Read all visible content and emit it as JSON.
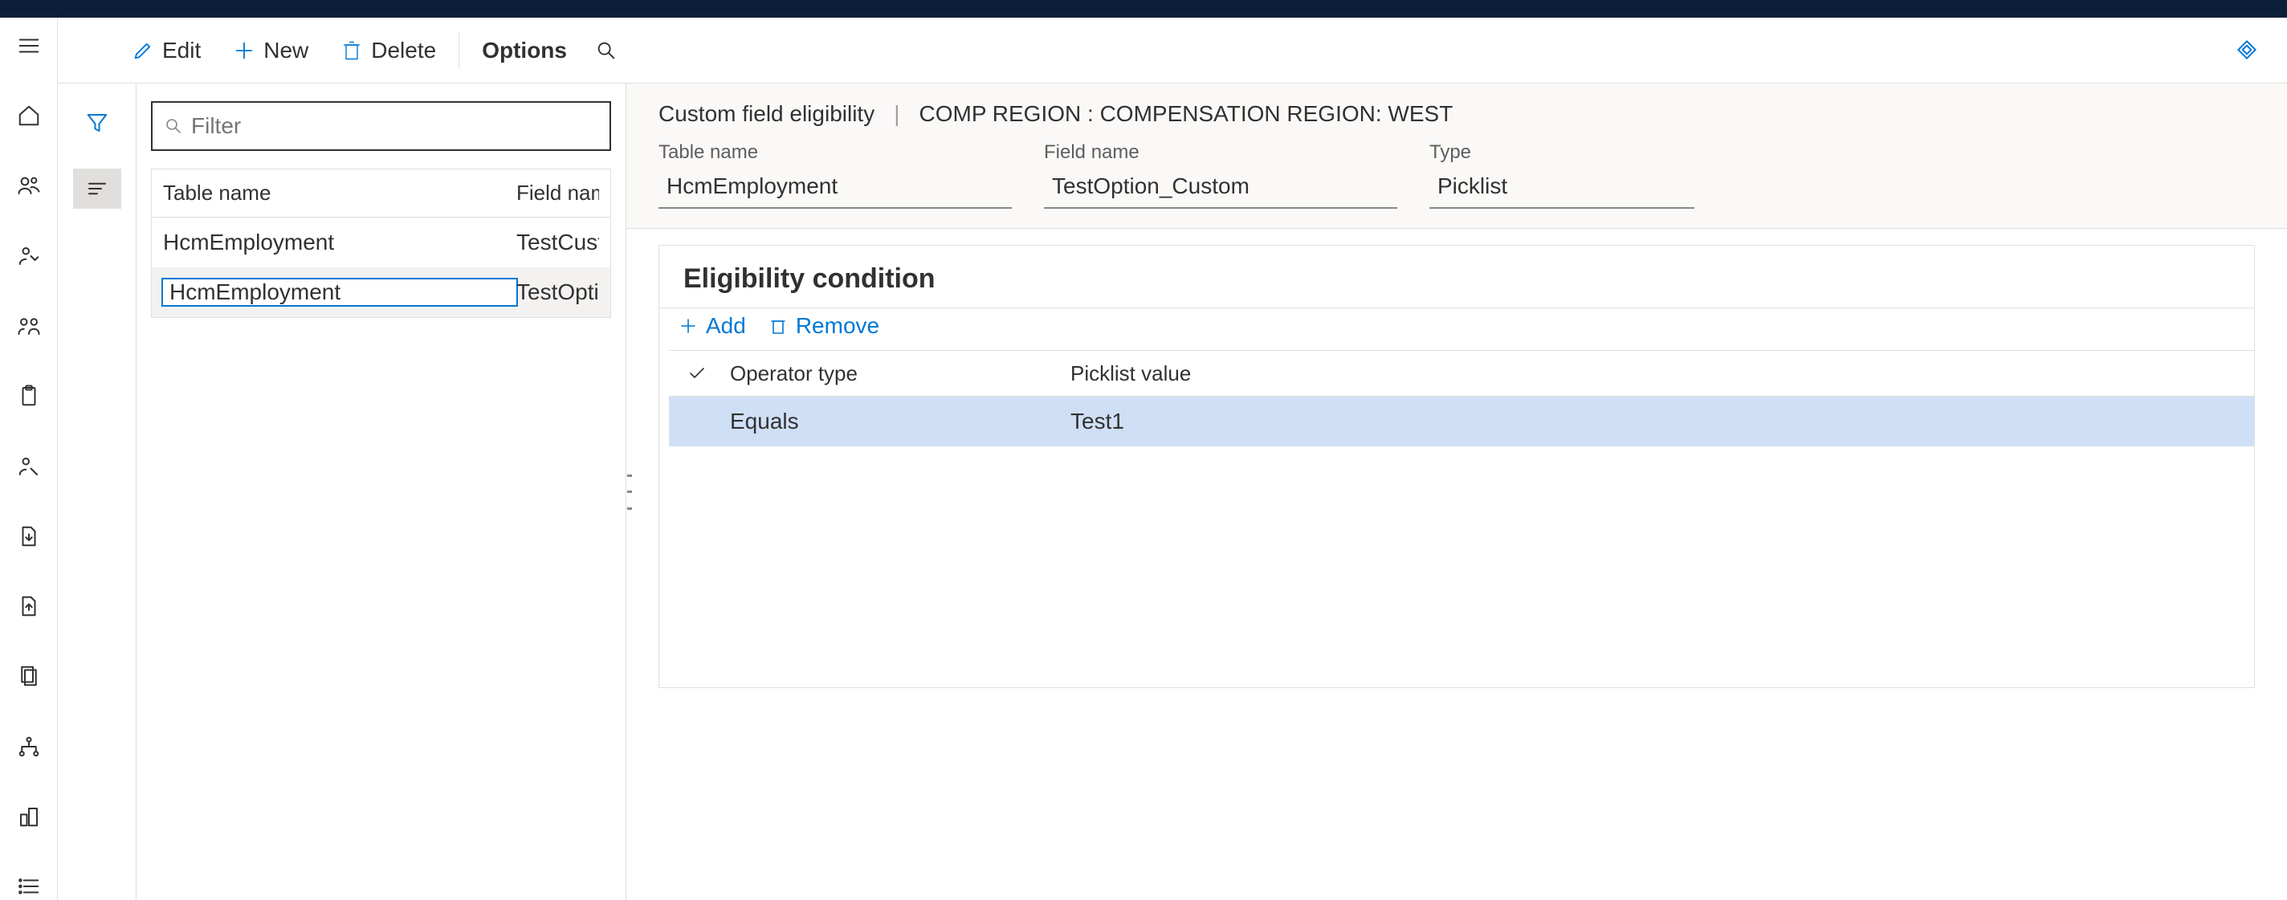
{
  "toolbar": {
    "edit": "Edit",
    "new": "New",
    "delete": "Delete",
    "options": "Options"
  },
  "filter": {
    "placeholder": "Filter"
  },
  "list": {
    "col1": "Table name",
    "col2": "Field name",
    "rows": [
      {
        "table": "HcmEmployment",
        "field": "TestCust"
      },
      {
        "table": "HcmEmployment",
        "field": "TestOpti"
      }
    ]
  },
  "breadcrumb": {
    "page": "Custom field eligibility",
    "context": "COMP REGION : COMPENSATION REGION: WEST"
  },
  "headerFields": {
    "tableName": {
      "label": "Table name",
      "value": "HcmEmployment"
    },
    "fieldName": {
      "label": "Field name",
      "value": "TestOption_Custom"
    },
    "type": {
      "label": "Type",
      "value": "Picklist"
    }
  },
  "section": {
    "title": "Eligibility condition",
    "add": "Add",
    "remove": "Remove",
    "cols": {
      "operator": "Operator type",
      "picklist": "Picklist value"
    },
    "rows": [
      {
        "operator": "Equals",
        "picklist": "Test1"
      }
    ]
  }
}
